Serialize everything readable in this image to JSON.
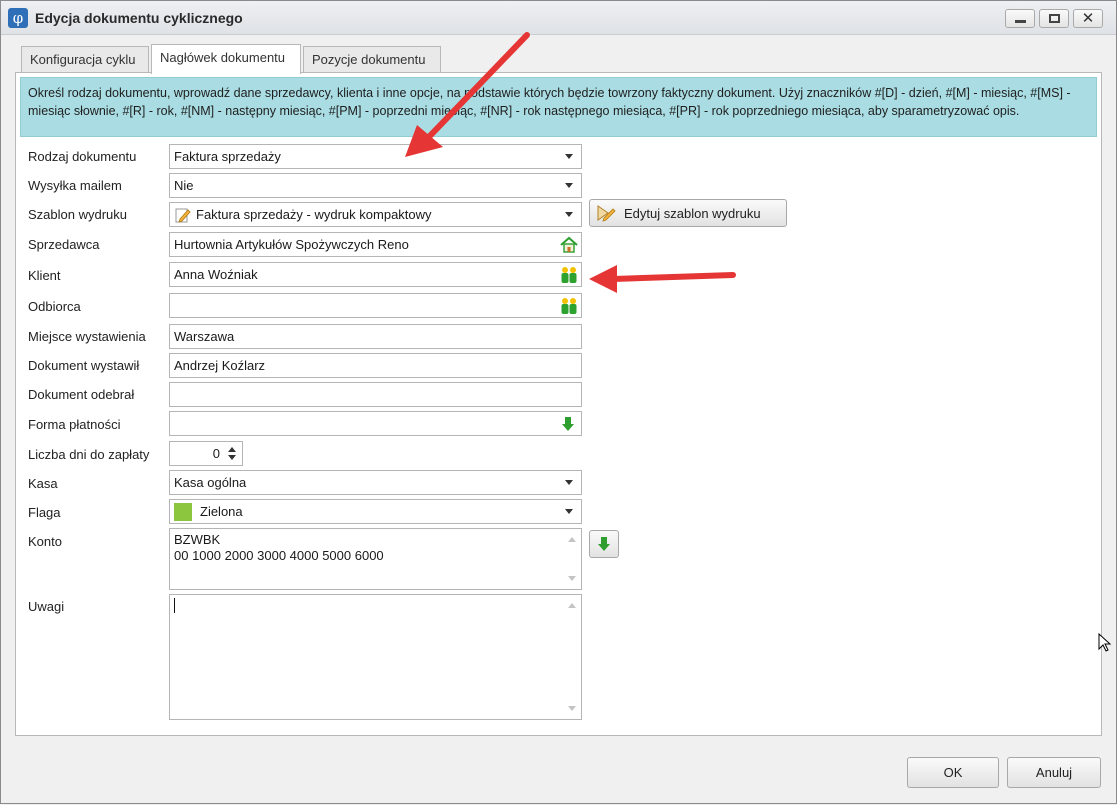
{
  "window": {
    "title": "Edycja dokumentu cyklicznego",
    "app_glyph": "φ"
  },
  "tabs": [
    {
      "label": "Konfiguracja cyklu",
      "active": false
    },
    {
      "label": "Nagłówek dokumentu",
      "active": true
    },
    {
      "label": "Pozycje dokumentu",
      "active": false
    }
  ],
  "info": {
    "text": "Określ rodzaj dokumentu, wprowadź dane sprzedawcy, klienta i inne opcje, na podstawie których będzie towrzony faktyczny dokument. Użyj znaczników #[D] - dzień, #[M] - miesiąc, #[MS] - miesiąc słownie, #[R] - rok, #[NM] - następny miesiąc, #[PM] - poprzedni miesiąc, #[NR] - rok następnego miesiąca, #[PR] - rok poprzedniego miesiąca, aby sparametryzować opis."
  },
  "form": {
    "rodzaj": {
      "label": "Rodzaj dokumentu",
      "value": "Faktura sprzedaży"
    },
    "wysylka": {
      "label": "Wysyłka mailem",
      "value": "Nie"
    },
    "szablon": {
      "label": "Szablon wydruku",
      "value": "Faktura sprzedaży - wydruk kompaktowy",
      "edit_button": "Edytuj szablon wydruku"
    },
    "sprzedawca": {
      "label": "Sprzedawca",
      "value": "Hurtownia Artykułów Spożywczych Reno"
    },
    "klient": {
      "label": "Klient",
      "value": "Anna Woźniak"
    },
    "odbiorca": {
      "label": "Odbiorca",
      "value": ""
    },
    "miejsce": {
      "label": "Miejsce wystawienia",
      "value": "Warszawa"
    },
    "wystawil": {
      "label": "Dokument wystawił",
      "value": "Andrzej Koźlarz"
    },
    "odebral": {
      "label": "Dokument odebrał",
      "value": ""
    },
    "platnosc": {
      "label": "Forma płatności",
      "value": ""
    },
    "dni": {
      "label": "Liczba dni do zapłaty",
      "value": "0"
    },
    "kasa": {
      "label": "Kasa",
      "value": "Kasa ogólna"
    },
    "flaga": {
      "label": "Flaga",
      "value": "Zielona",
      "color": "#8cc63f"
    },
    "konto": {
      "label": "Konto",
      "line1": "BZWBK",
      "line2": "00 1000 2000 3000 4000 5000 6000"
    },
    "uwagi": {
      "label": "Uwagi",
      "value": ""
    }
  },
  "footer": {
    "ok": "OK",
    "cancel": "Anuluj"
  },
  "colors": {
    "info_bg": "#a9dde3",
    "annotation_arrow": "#e53535",
    "accent_green": "#2e9e2e"
  }
}
